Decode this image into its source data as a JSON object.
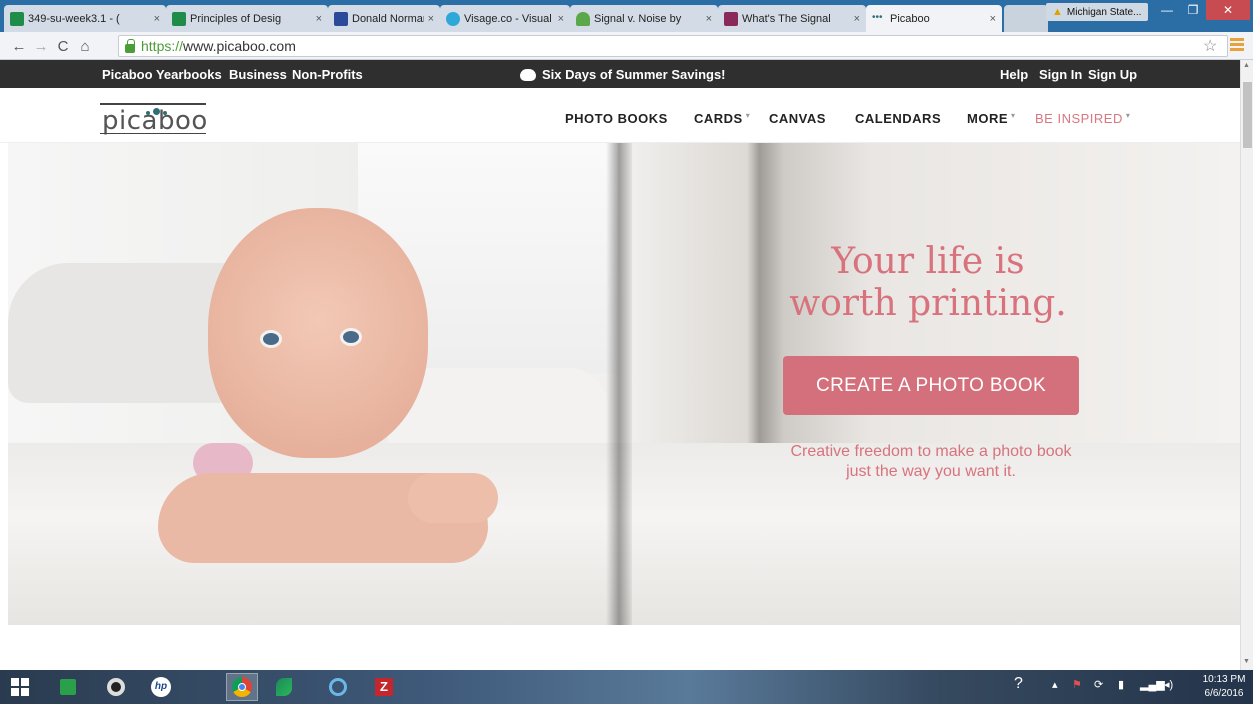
{
  "browser": {
    "tabs": [
      {
        "title": "349-su-week3.1 - (",
        "favicon": "s-icon",
        "color": "#1f8c4a"
      },
      {
        "title": "Principles of Desig",
        "favicon": "s-icon",
        "color": "#1f8c4a"
      },
      {
        "title": "Donald Norman's",
        "favicon": "hbr-icon",
        "color": "#2b4a9a"
      },
      {
        "title": "Visage.co - Visual",
        "favicon": "visage-icon",
        "color": "#2ea8d8"
      },
      {
        "title": "Signal v. Noise by",
        "favicon": "signal-icon",
        "color": "#5aa84a"
      },
      {
        "title": "What's The Signal",
        "favicon": "grid-icon",
        "color": "#8a2a5a"
      },
      {
        "title": "Picaboo",
        "favicon": "picaboo-icon",
        "color": "#2f6f73"
      }
    ],
    "tab_close": "×",
    "profile_name": "Michigan State...",
    "url": {
      "scheme": "https://",
      "host": "www.picaboo.com"
    }
  },
  "topbar": {
    "left_links": [
      "Picaboo Yearbooks",
      "Business",
      "Non-Profits"
    ],
    "promo": "Six Days of Summer Savings!",
    "right_links": [
      "Help",
      "Sign In",
      "Sign Up"
    ]
  },
  "nav": {
    "logo_text": "picaboo",
    "items": [
      {
        "label": "PHOTO BOOKS",
        "dropdown": false
      },
      {
        "label": "CARDS",
        "dropdown": true
      },
      {
        "label": "CANVAS",
        "dropdown": false
      },
      {
        "label": "CALENDARS",
        "dropdown": false
      },
      {
        "label": "MORE",
        "dropdown": true
      },
      {
        "label": "BE INSPIRED",
        "dropdown": true
      }
    ],
    "accent": "#d97680"
  },
  "hero": {
    "headline_line1": "Your life is",
    "headline_line2": "worth printing.",
    "cta": "CREATE A PHOTO BOOK",
    "tagline": "Creative freedom to make a photo book just the way you want it."
  },
  "taskbar": {
    "apps": [
      "windows-start-icon",
      "store-icon",
      "media-icon",
      "hp-icon",
      "chrome-icon",
      "app-icon",
      "browser-icon",
      "filezilla-icon"
    ],
    "clock_time": "10:13 PM",
    "clock_date": "6/6/2016"
  }
}
